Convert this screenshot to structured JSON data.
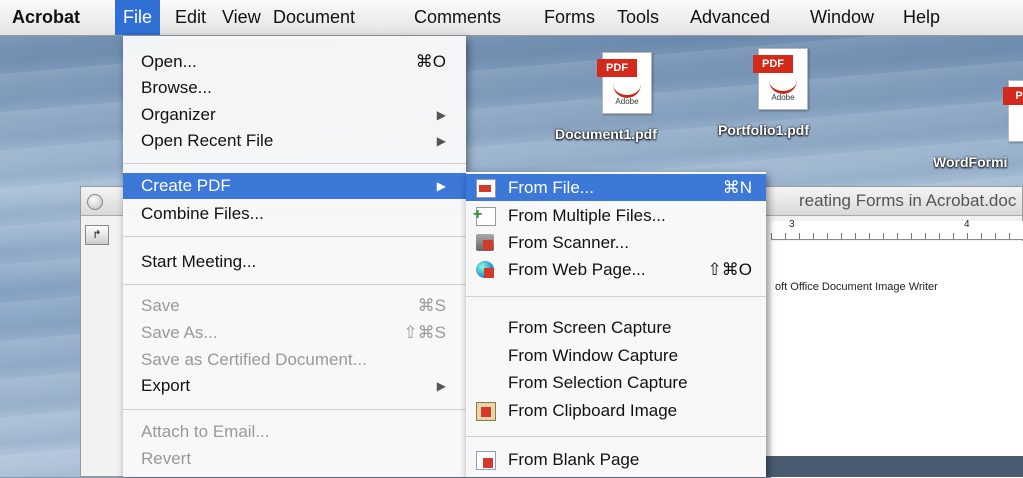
{
  "menubar": {
    "app": "Acrobat",
    "items": [
      "File",
      "Edit",
      "View",
      "Document",
      "Comments",
      "Forms",
      "Tools",
      "Advanced",
      "Window",
      "Help"
    ],
    "active": "File"
  },
  "desktop": {
    "icons": [
      {
        "label": "Document1.pdf",
        "tag": "PDF",
        "brand": "Adobe"
      },
      {
        "label": "Portfolio1.pdf",
        "tag": "PDF",
        "brand": "Adobe"
      },
      {
        "label": "WordFormi",
        "tag": "PD",
        "brand": ""
      }
    ]
  },
  "document_window": {
    "title": "reating Forms in Acrobat.doc",
    "ruler_marks": [
      "3",
      "4"
    ],
    "text": "oft Office Document Image Writer"
  },
  "file_menu": {
    "items": [
      {
        "label": "Open...",
        "shortcut": "⌘O"
      },
      {
        "label": "Browse...",
        "shortcut": ""
      },
      {
        "label": "Organizer",
        "shortcut": "",
        "submenu": true
      },
      {
        "label": "Open Recent File",
        "shortcut": "",
        "submenu": true
      },
      {
        "label": "Create PDF",
        "shortcut": "",
        "submenu": true,
        "selected": true
      },
      {
        "label": "Combine Files...",
        "shortcut": ""
      },
      {
        "label": "Start Meeting...",
        "shortcut": ""
      },
      {
        "label": "Save",
        "shortcut": "⌘S",
        "disabled": true
      },
      {
        "label": "Save As...",
        "shortcut": "⇧⌘S",
        "disabled": true
      },
      {
        "label": "Save as Certified Document...",
        "shortcut": "",
        "disabled": true
      },
      {
        "label": "Export",
        "shortcut": "",
        "submenu": true
      },
      {
        "label": "Attach to Email...",
        "shortcut": "",
        "disabled": true
      },
      {
        "label": "Revert",
        "shortcut": "",
        "disabled": true
      }
    ]
  },
  "create_pdf_submenu": {
    "items": [
      {
        "label": "From File...",
        "shortcut": "⌘N",
        "icon": "pdf-file-icon",
        "selected": true
      },
      {
        "label": "From Multiple Files...",
        "shortcut": "",
        "icon": "multiple-files-icon"
      },
      {
        "label": "From Scanner...",
        "shortcut": "",
        "icon": "scanner-icon"
      },
      {
        "label": "From Web Page...",
        "shortcut": "⇧⌘O",
        "icon": "web-page-icon"
      },
      {
        "label": "From Screen Capture",
        "shortcut": ""
      },
      {
        "label": "From Window Capture",
        "shortcut": ""
      },
      {
        "label": "From Selection Capture",
        "shortcut": ""
      },
      {
        "label": "From Clipboard Image",
        "shortcut": "",
        "icon": "clipboard-icon"
      },
      {
        "label": "From Blank Page",
        "shortcut": "",
        "icon": "blank-page-icon"
      }
    ]
  },
  "colors": {
    "highlight": "#3b78d8",
    "menubar_active": "#2f6fd6",
    "pdf_red": "#d42a1c"
  }
}
